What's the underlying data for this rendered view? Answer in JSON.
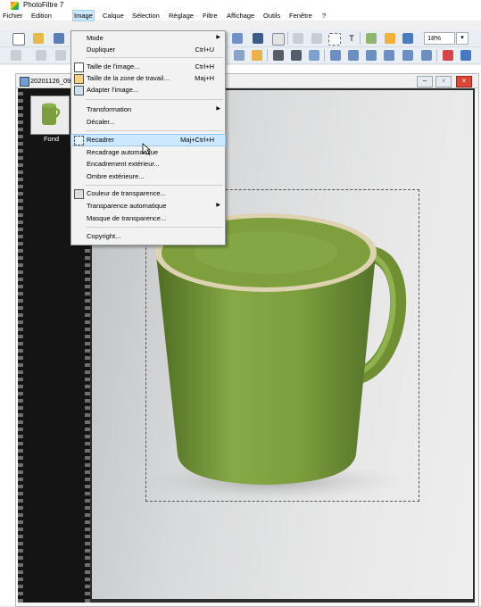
{
  "app": {
    "title": "PhotoFiltre 7"
  },
  "menubar": {
    "items": [
      "Fichier",
      "Edition",
      "Image",
      "Calque",
      "Sélection",
      "Réglage",
      "Filtre",
      "Affichage",
      "Outils",
      "Fenêtre",
      "?"
    ]
  },
  "toolbar": {
    "zoom": "18%"
  },
  "document": {
    "title": "20201126_09"
  },
  "layers": {
    "items": [
      {
        "label": "Fond"
      }
    ]
  },
  "image_menu": {
    "items": [
      {
        "label": "Mode",
        "shortcut": "",
        "submenu": true
      },
      {
        "label": "Dupliquer",
        "shortcut": "Ctrl+U"
      },
      {
        "label": "Taille de l'image...",
        "shortcut": "Ctrl+H"
      },
      {
        "label": "Taille de la zone de travail...",
        "shortcut": "Maj+H"
      },
      {
        "label": "Adapter l'image...",
        "shortcut": ""
      },
      {
        "label": "Transformation",
        "shortcut": "",
        "submenu": true
      },
      {
        "label": "Décaler...",
        "shortcut": ""
      },
      {
        "label": "Recadrer",
        "shortcut": "Maj+Ctrl+H",
        "highlighted": true
      },
      {
        "label": "Recadrage automatique",
        "shortcut": ""
      },
      {
        "label": "Encadrement extérieur...",
        "shortcut": ""
      },
      {
        "label": "Ombre extérieure...",
        "shortcut": ""
      },
      {
        "label": "Couleur de transparence...",
        "shortcut": ""
      },
      {
        "label": "Transparence automatique",
        "shortcut": "",
        "submenu": true
      },
      {
        "label": "Masque de transparence...",
        "shortcut": ""
      },
      {
        "label": "Copyright...",
        "shortcut": ""
      }
    ]
  },
  "colors": {
    "highlight": "#cce8ff",
    "mug": "#7d9e3e",
    "menu_bg": "#f2f2f2"
  },
  "icons": [
    "app-icon",
    "document-icon",
    "minimize-icon",
    "maximize-icon",
    "close-icon",
    "crop-icon",
    "resize-icon",
    "transparency-icon",
    "pointer-cursor-icon"
  ]
}
